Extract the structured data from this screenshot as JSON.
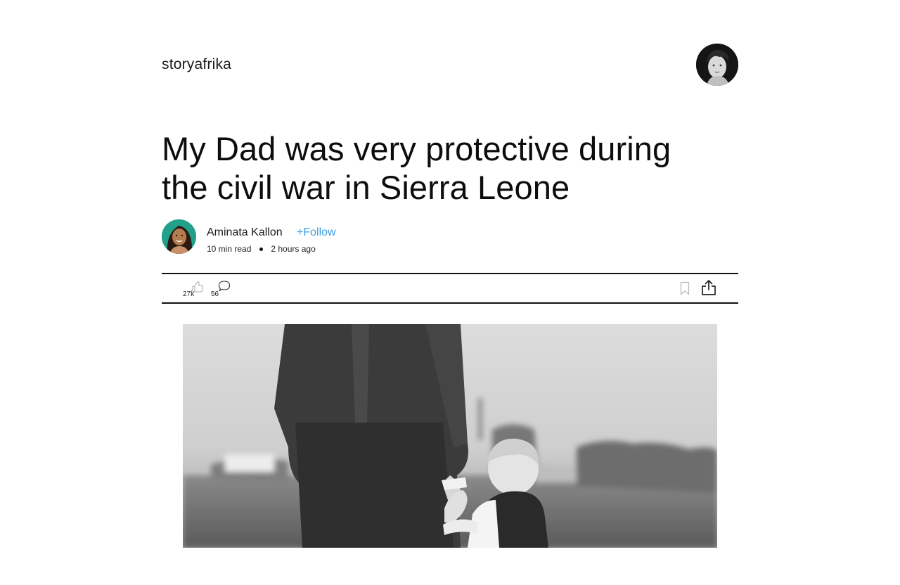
{
  "header": {
    "brand": "storyafrika",
    "user_avatar_icon": "user-avatar"
  },
  "article": {
    "title": "My Dad was very protective during the civil war in Sierra Leone",
    "author": {
      "name": "Aminata Kallon",
      "follow_label": "+Follow",
      "read_time": "10 min read",
      "posted": "2 hours ago"
    },
    "actions": {
      "likes": "27k",
      "comments": "56",
      "like_icon": "thumbs-up-icon",
      "comment_icon": "comment-bubble-icon",
      "bookmark_icon": "bookmark-icon",
      "share_icon": "share-icon"
    },
    "hero_image": "grayscale photo of a father in a suit holding a small child's hand in a field"
  },
  "colors": {
    "follow": "#3aa0e4",
    "text": "#111111",
    "background": "#ffffff"
  }
}
